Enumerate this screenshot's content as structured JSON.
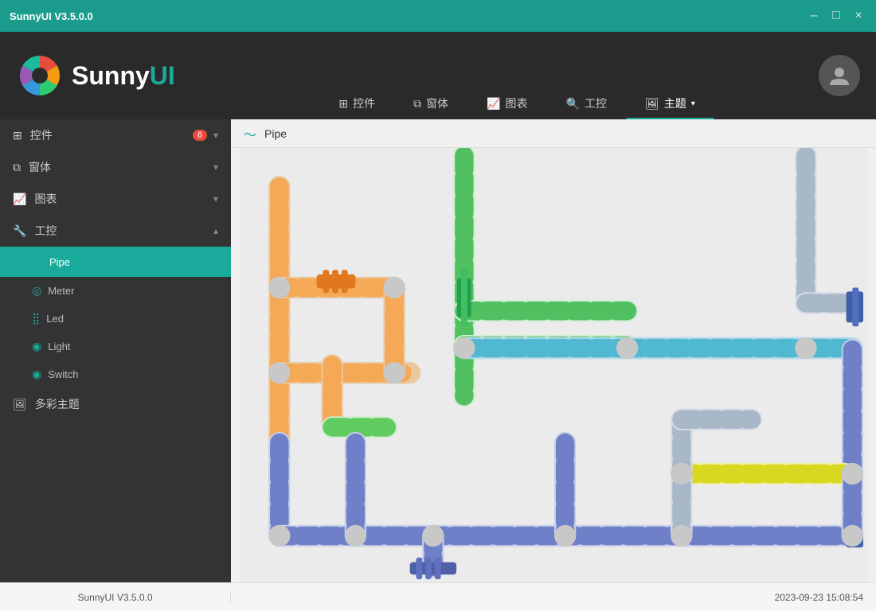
{
  "titlebar": {
    "title": "SunnyUI V3.5.0.0",
    "controls": [
      "–",
      "□",
      "×"
    ]
  },
  "header": {
    "logo_text_light": "Sunny",
    "logo_text_accent": "UI",
    "nav_tabs": [
      {
        "label": "控件",
        "icon": "⊞",
        "active": false
      },
      {
        "label": "窗体",
        "icon": "⧉",
        "active": false
      },
      {
        "label": "图表",
        "icon": "📈",
        "active": false
      },
      {
        "label": "工控",
        "icon": "🔍",
        "active": false
      },
      {
        "label": "主题",
        "icon": "🖼",
        "active": true
      }
    ]
  },
  "sidebar": {
    "items": [
      {
        "label": "控件",
        "icon": "⊞",
        "badge": "6",
        "expanded": false,
        "sub": []
      },
      {
        "label": "窗体",
        "icon": "⧉",
        "badge": "",
        "expanded": false,
        "sub": []
      },
      {
        "label": "图表",
        "icon": "📈",
        "badge": "",
        "expanded": false,
        "sub": []
      },
      {
        "label": "工控",
        "icon": "🔧",
        "badge": "",
        "expanded": true,
        "sub": [
          {
            "label": "Pipe",
            "icon": "〜",
            "active": true
          },
          {
            "label": "Meter",
            "icon": "◎",
            "active": false
          },
          {
            "label": "Led",
            "icon": "⣿",
            "active": false
          },
          {
            "label": "Light",
            "icon": "◉",
            "active": false
          },
          {
            "label": "Switch",
            "icon": "◉",
            "active": false
          }
        ]
      },
      {
        "label": "多彩主题",
        "icon": "🖼",
        "badge": "",
        "expanded": false,
        "sub": []
      }
    ]
  },
  "content": {
    "header_icon": "〜",
    "header_title": "Pipe"
  },
  "statusbar": {
    "left": "SunnyUI V3.5.0.0",
    "right": "2023-09-23 15:08:54"
  }
}
